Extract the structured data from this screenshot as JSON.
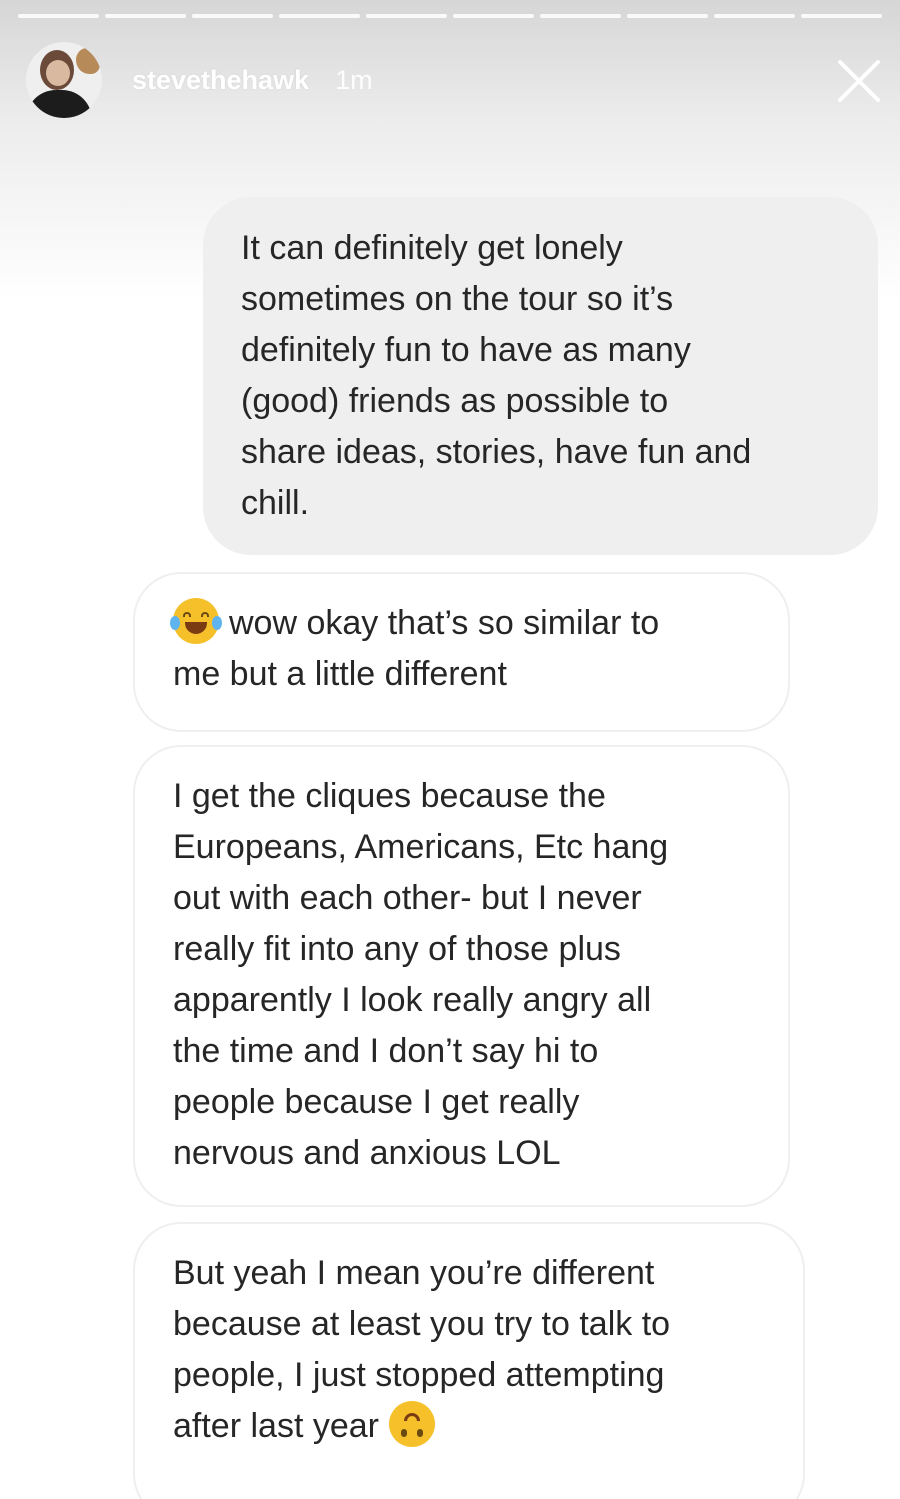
{
  "story": {
    "progress_segment_count": 10,
    "username": "stevethehawk",
    "timestamp": "1m"
  },
  "messages": {
    "sent_1": "It can definitely get lonely\nsometimes on the tour so it’s\ndefinitely fun to have as many\n(good) friends as possible to\nshare ideas, stories, have fun and\nchill.",
    "received_1_line1": "wow okay that’s so similar to",
    "received_1_line2": "me but a little different",
    "received_2": "I get the cliques because the\nEuropeans, Americans, Etc hang\nout with each other- but I never\nreally fit into any of those plus\napparently I look really angry all\nthe time and I don’t say hi to\npeople because I get really\nnervous and anxious LOL",
    "received_3": "But yeah I mean you’re different\nbecause at least you try to talk to\npeople, I just stopped attempting\nafter last year"
  },
  "icons": {
    "close": "close-icon",
    "emoji_1": "face-with-tears-of-joy-emoji",
    "emoji_2": "upside-down-face-emoji"
  },
  "colors": {
    "sent_bubble": "#efefef",
    "received_border": "#efefef",
    "text": "#262626"
  }
}
